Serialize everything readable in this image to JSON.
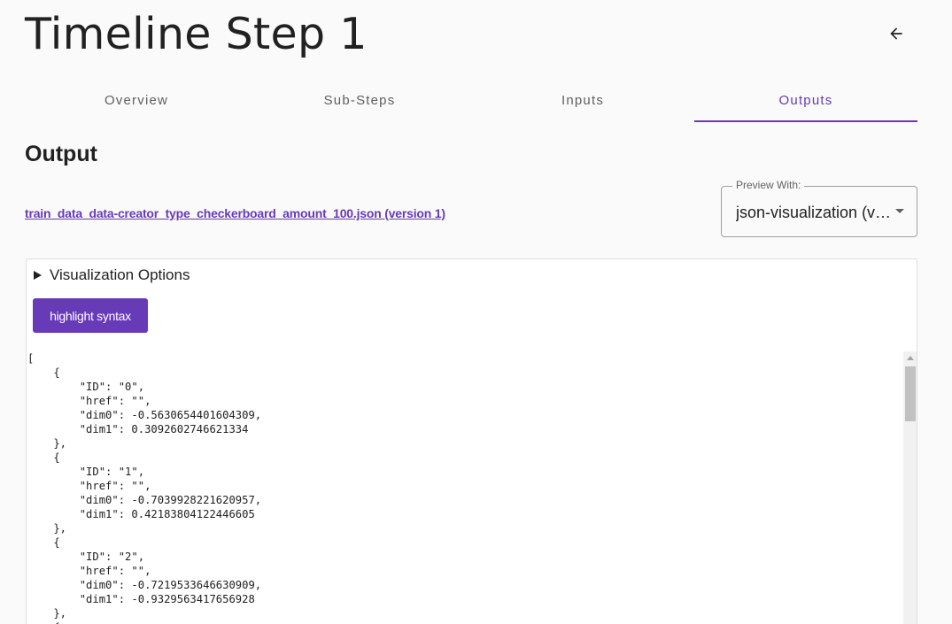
{
  "header": {
    "title": "Timeline Step 1",
    "back_icon": "arrow-left-icon"
  },
  "tabs": [
    {
      "label": "Overview",
      "active": false
    },
    {
      "label": "Sub-Steps",
      "active": false
    },
    {
      "label": "Inputs",
      "active": false
    },
    {
      "label": "Outputs",
      "active": true
    }
  ],
  "output": {
    "section_title": "Output",
    "file_link": "train_data_data-creator_type_checkerboard_amount_100.json (version 1)",
    "preview": {
      "label": "Preview With:",
      "value": "json-visualization (v…"
    }
  },
  "visualization": {
    "options_label": "Visualization Options",
    "highlight_button": "highlight syntax",
    "code": "[\n    {\n        \"ID\": \"0\",\n        \"href\": \"\",\n        \"dim0\": -0.5630654401604309,\n        \"dim1\": 0.3092602746621334\n    },\n    {\n        \"ID\": \"1\",\n        \"href\": \"\",\n        \"dim0\": -0.7039928221620957,\n        \"dim1\": 0.42183804122446605\n    },\n    {\n        \"ID\": \"2\",\n        \"href\": \"\",\n        \"dim0\": -0.7219533646630909,\n        \"dim1\": -0.9329563417656928\n    },\n    {"
  },
  "colors": {
    "accent": "#673ab7",
    "text": "#212121",
    "muted": "#5f5f5f",
    "background": "#fafafa"
  }
}
